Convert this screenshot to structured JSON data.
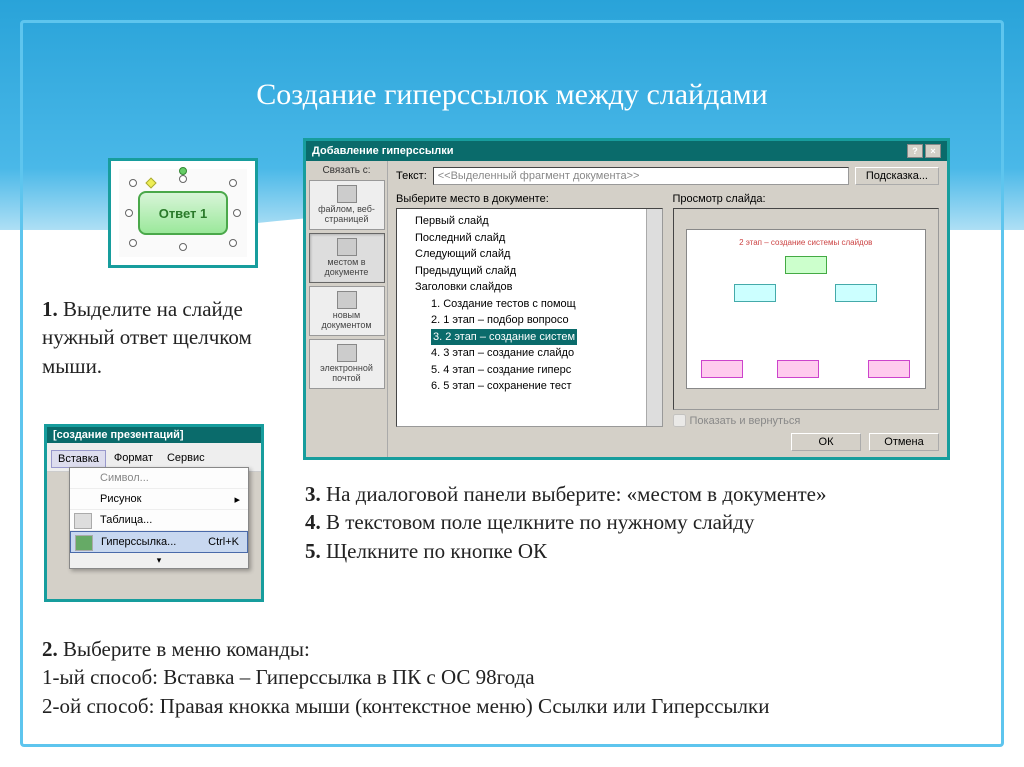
{
  "slide": {
    "title": "Создание гиперссылок между слайдами"
  },
  "answer": {
    "btn_label": "Ответ 1"
  },
  "step1": {
    "num": "1.",
    "text": " Выделите на слайде нужный ответ щелчком мыши."
  },
  "dialog": {
    "title": "Добавление гиперссылки",
    "link_label": "Связать с:",
    "text_label": "Текст:",
    "text_value": "<<Выделенный фрагмент документа>>",
    "tip_btn": "Подсказка...",
    "sidebar": {
      "file": "файлом, веб-страницей",
      "place": "местом в документе",
      "newdoc": "новым документом",
      "email": "электронной почтой"
    },
    "tree_label": "Выберите место в документе:",
    "preview_label": "Просмотр слайда:",
    "tree": {
      "first": "Первый слайд",
      "last": "Последний слайд",
      "next": "Следующий слайд",
      "prev": "Предыдущий слайд",
      "headers": "Заголовки слайдов",
      "s1": "1. Создание тестов с помощ",
      "s2": "2. 1 этап – подбор вопросо",
      "s3": "3. 2 этап – создание систем",
      "s4": "4. 3 этап – создание слайдо",
      "s5": "5. 4 этап – создание гиперс",
      "s6": "6. 5 этап – сохранение тест"
    },
    "preview_title": "2 этап – создание системы слайдов",
    "show_return": "Показать и вернуться",
    "ok": "ОК",
    "cancel": "Отмена"
  },
  "menu": {
    "title": "[создание презентаций]",
    "insert": "Вставка",
    "format": "Формат",
    "service": "Сервис",
    "symbol": "Символ...",
    "picture": "Рисунок",
    "table": "Таблица...",
    "hyperlink": "Гиперссылка...",
    "shortcut": "Ctrl+K"
  },
  "step3": {
    "n3": "3.",
    "t3": " На диалоговой панели выберите: «местом в документе»",
    "n4": "4.",
    "t4": " В текстовом поле щелкните по нужному слайду",
    "n5": "5.",
    "t5": " Щелкните по кнопке ОК"
  },
  "step2": {
    "n2": "2.",
    "t2": " Выберите в меню команды:",
    "w1": "1-ый способ: Вставка – Гиперссылка в ПК с ОС 98года",
    "w2": "2-ой способ: Правая кнокка мыши (контекстное меню) Ссылки или Гиперссылки"
  }
}
